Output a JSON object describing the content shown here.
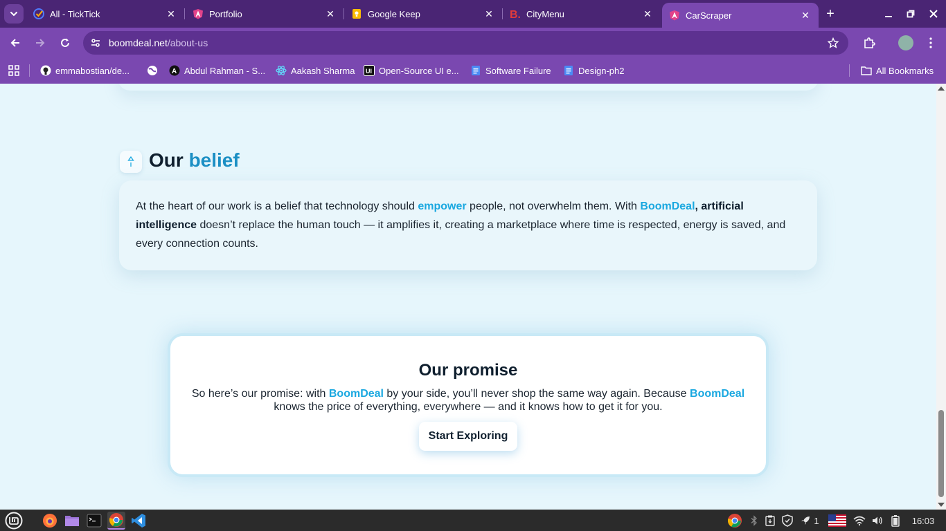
{
  "browser": {
    "tabs": [
      {
        "title": "All - TickTick",
        "icon": "ticktick-icon"
      },
      {
        "title": "Portfolio",
        "icon": "angular-icon"
      },
      {
        "title": "Google Keep",
        "icon": "keep-icon"
      },
      {
        "title": "CityMenu",
        "icon": "citymenu-icon"
      },
      {
        "title": "CarScraper",
        "icon": "angular-icon",
        "active": true
      }
    ],
    "url": {
      "host": "boomdeal.net",
      "path": "/about-us"
    },
    "bookmarks": [
      {
        "label": "emmabostian/de...",
        "icon": "github-icon"
      },
      {
        "label": "",
        "icon": "globe-icon"
      },
      {
        "label": "Abdul Rahman - S...",
        "icon": "a-logo-icon"
      },
      {
        "label": "Aakash Sharma",
        "icon": "react-icon"
      },
      {
        "label": "Open-Source UI e...",
        "icon": "ui-logo-icon"
      },
      {
        "label": "Software Failure",
        "icon": "docs-icon"
      },
      {
        "label": "Design-ph2",
        "icon": "docs-icon"
      }
    ],
    "all_bookmarks": "All Bookmarks"
  },
  "page": {
    "belief": {
      "title_plain": "Our ",
      "title_accent": "belief",
      "text_1": "At the heart of our work is a belief that technology should ",
      "hl_1": "empower",
      "text_2": " people, not overwhelm them. With ",
      "hl_2": "BoomDeal",
      "text_3": ", ",
      "strong_1": "artificial intelligence",
      "text_4": " doesn’t replace the human touch — it amplifies it, creating a marketplace where time is respected, energy is saved, and every connection counts."
    },
    "promise": {
      "title": "Our promise",
      "text_1": "So here’s our promise: with ",
      "hl_1": "BoomDeal",
      "text_2": " by your side, you’ll never shop the same way again. Because ",
      "hl_2": "BoomDeal",
      "text_3": " knows the price of everything, everywhere — and it knows how to get it for you.",
      "cta": "Start Exploring"
    }
  },
  "taskbar": {
    "notifications_count": "1",
    "clock": "16:03"
  },
  "colors": {
    "chrome_dark": "#4a2574",
    "chrome": "#7a48b0",
    "page_bg": "#e6f6fc",
    "accent": "#1aa8e0",
    "accent_title": "#1b8fc4"
  }
}
